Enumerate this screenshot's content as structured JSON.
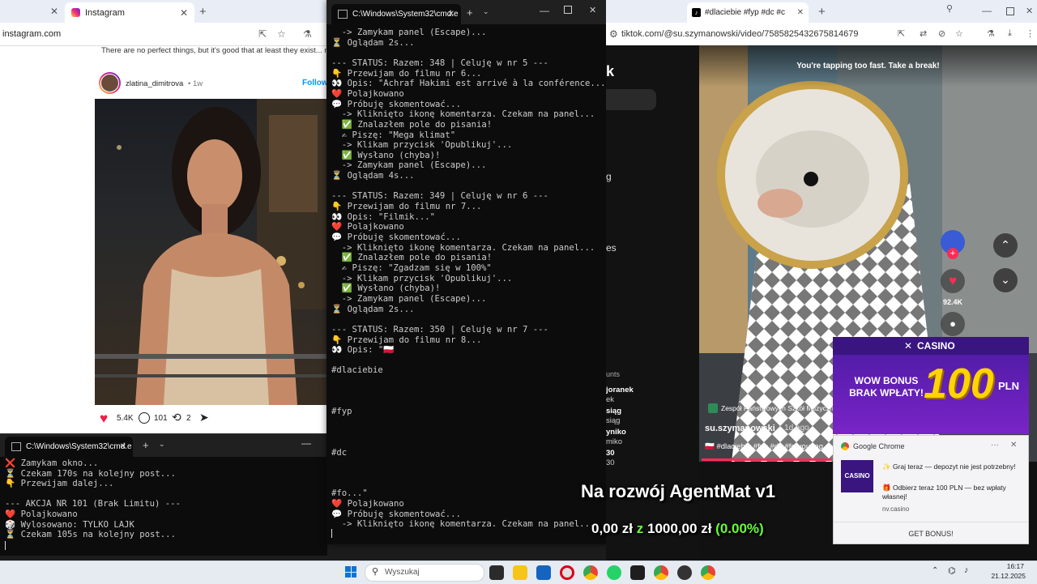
{
  "instagram": {
    "tab_title": "Instagram",
    "url": "instagram.com",
    "caption_snippet": "There are no perfect things, but it's good that at least they exist... m",
    "username": "zlatina_dimitrova",
    "post_age": "• 1w",
    "follow_label": "Follow",
    "likes": "5.4K",
    "comments": "101",
    "reposts": "2"
  },
  "cmd_main": {
    "tab_title": "C:\\Windows\\System32\\cmd.e",
    "lines": [
      "  -> Zamykam panel (Escape)...",
      "⏳ Oglądam 2s...",
      "",
      "--- STATUS: Razem: 348 | Celuję w nr 5 ---",
      "👇 Przewijam do filmu nr 6...",
      "👀 Opis: \"Achraf Hakimi est arrivé à la conférence...\"",
      "❤️ Polajkowano",
      "💬 Próbuję skomentować...",
      "  -> Kliknięto ikonę komentarza. Czekam na panel...",
      "  ✅ Znalazłem pole do pisania!",
      "  ✍ Piszę: \"Mega klimat\"",
      "  -> Klikam przycisk 'Opublikuj'...",
      "  ✅ Wysłano (chyba)!",
      "  -> Zamykam panel (Escape)...",
      "⏳ Oglądam 4s...",
      "",
      "--- STATUS: Razem: 349 | Celuję w nr 6 ---",
      "👇 Przewijam do filmu nr 7...",
      "👀 Opis: \"Filmik...\"",
      "❤️ Polajkowano",
      "💬 Próbuję skomentować...",
      "  -> Kliknięto ikonę komentarza. Czekam na panel...",
      "  ✅ Znalazłem pole do pisania!",
      "  ✍ Piszę: \"Zgadzam się w 100%\"",
      "  -> Klikam przycisk 'Opublikuj'...",
      "  ✅ Wysłano (chyba)!",
      "  -> Zamykam panel (Escape)...",
      "⏳ Oglądam 2s...",
      "",
      "--- STATUS: Razem: 350 | Celuję w nr 7 ---",
      "👇 Przewijam do filmu nr 8...",
      "👀 Opis: \"🇵🇱",
      "",
      "#dlaciebie",
      "",
      "",
      "",
      "#fyp",
      "",
      "",
      "",
      "#dc",
      "",
      "",
      "",
      "#fo...\"",
      "❤️ Polajkowano",
      "💬 Próbuję skomentować...",
      "  -> Kliknięto ikonę komentarza. Czekam na panel..."
    ]
  },
  "cmd_small": {
    "tab_title": "C:\\Windows\\System32\\cmd.e",
    "lines": [
      "❌ Zamykam okno...",
      "⏳ Czekam 170s na kolejny post...",
      "👇 Przewijam dalej...",
      "",
      "--- AKCJA NR 101 (Brak Limitu) ---",
      "❤️ Polajkowano",
      "🎲 Wylosowano: TYLKO LAJK",
      "⏳ Czekam 105s na kolejny post..."
    ]
  },
  "tiktok": {
    "tab_title": "#dlaciebie #fyp #dc #c",
    "url": "tiktok.com/@su.szymanowski/video/7585825432675814679",
    "banner": "You're tapping too fast. Take a break!",
    "side_letters": [
      "k",
      "g",
      "es"
    ],
    "likes": "92.4K",
    "comments_header": "unts",
    "comment_snips": [
      "joranek",
      "ek",
      "siąg",
      "siąg",
      "yniko",
      "miko",
      "30",
      "30"
    ],
    "school_label": "Zespół Państwowych Szkół Muzyczn",
    "author": "su.szymanowski",
    "author_age": "· 1d ago",
    "description": "🇵🇱 #dlaciebie #fyp #dc #foryoupag"
  },
  "casino_ad": {
    "brand": "CASINO",
    "headline": "WOW BONUS BRAK WPŁATY!",
    "amount": "100",
    "currency": "PLN"
  },
  "chrome_notification": {
    "app": "Google Chrome",
    "line1": "✨ Graj teraz — depozyt nie jest potrzebny!",
    "line2": "🎁 Odbierz teraz 100 PLN — bez wpłaty własnej!",
    "domain": "nv.casino",
    "button": "GET BONUS!"
  },
  "overlay": {
    "title": "Na rozwój AgentMat v1",
    "current": "0,00 zł",
    "separator": "z",
    "goal": "1000,00 zł",
    "percent": "(0.00%)",
    "percent_color": "#66ff33",
    "separator_color": "#66ff33"
  },
  "taskbar": {
    "search_placeholder": "Wyszukaj",
    "time": "16:17",
    "date": "21.12.2025"
  }
}
